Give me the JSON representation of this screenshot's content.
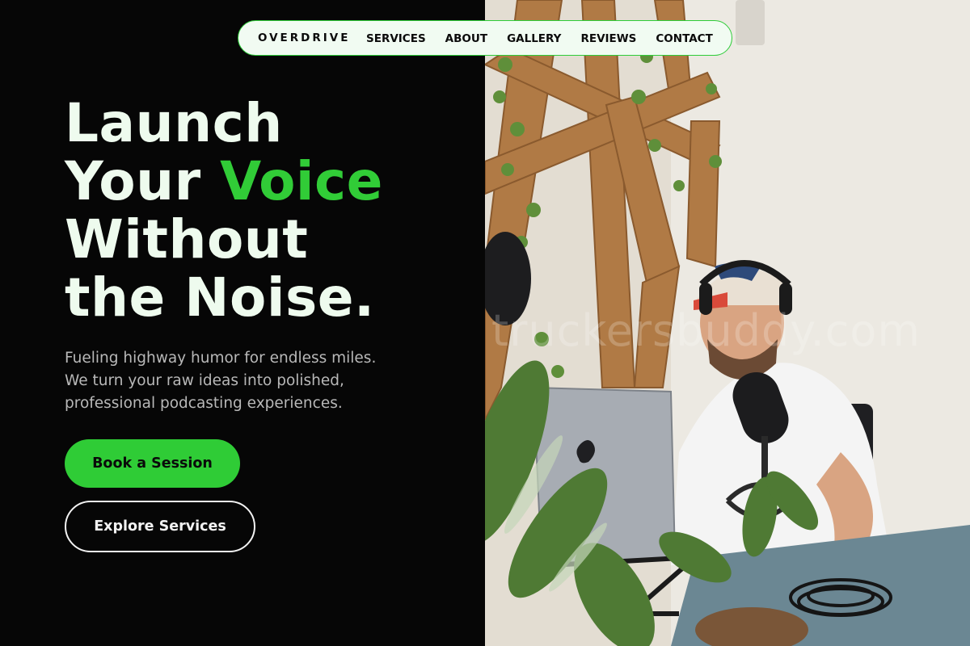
{
  "nav": {
    "brand": "OVERDRIVE",
    "links": [
      "SERVICES",
      "ABOUT",
      "GALLERY",
      "REVIEWS",
      "CONTACT"
    ]
  },
  "hero": {
    "headline_line1": "Launch",
    "headline_line2_a": "Your ",
    "headline_line2_b": "Voice",
    "headline_line3": "Without",
    "headline_line4": "the Noise.",
    "subtitle_line1": "Fueling highway humor for endless miles.",
    "subtitle_line2": "We turn your raw ideas into polished,",
    "subtitle_line3": "professional podcasting experiences.",
    "primary_button": "Book a Session",
    "secondary_button": "Explore Services"
  },
  "image": {
    "watermark": "truckersbuddy.com",
    "description_icon": "podcaster-photo"
  },
  "colors": {
    "accent": "#31cc37",
    "background": "#060606",
    "nav_bg": "#f1fbf2",
    "headline": "#eefbee"
  }
}
